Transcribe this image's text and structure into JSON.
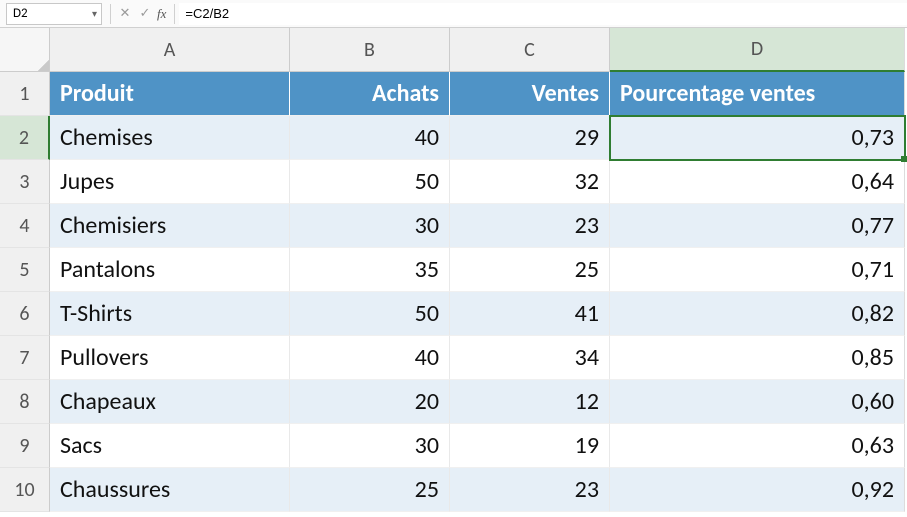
{
  "nameBox": "D2",
  "formula": "=C2/B2",
  "colLetters": [
    "A",
    "B",
    "C",
    "D"
  ],
  "rowNumbers": [
    "1",
    "2",
    "3",
    "4",
    "5",
    "6",
    "7",
    "8",
    "9",
    "10"
  ],
  "headers": {
    "produit": "Produit",
    "achats": "Achats",
    "ventes": "Ventes",
    "pourcentage": "Pourcentage ventes"
  },
  "rows": [
    {
      "produit": "Chemises",
      "achats": "40",
      "ventes": "29",
      "pct": "0,73"
    },
    {
      "produit": "Jupes",
      "achats": "50",
      "ventes": "32",
      "pct": "0,64"
    },
    {
      "produit": "Chemisiers",
      "achats": "30",
      "ventes": "23",
      "pct": "0,77"
    },
    {
      "produit": "Pantalons",
      "achats": "35",
      "ventes": "25",
      "pct": "0,71"
    },
    {
      "produit": "T-Shirts",
      "achats": "50",
      "ventes": "41",
      "pct": "0,82"
    },
    {
      "produit": "Pullovers",
      "achats": "40",
      "ventes": "34",
      "pct": "0,85"
    },
    {
      "produit": "Chapeaux",
      "achats": "20",
      "ventes": "12",
      "pct": "0,60"
    },
    {
      "produit": "Sacs",
      "achats": "30",
      "ventes": "19",
      "pct": "0,63"
    },
    {
      "produit": "Chaussures",
      "achats": "25",
      "ventes": "23",
      "pct": "0,92"
    }
  ],
  "selectedRow": 2,
  "selectedCol": "D"
}
